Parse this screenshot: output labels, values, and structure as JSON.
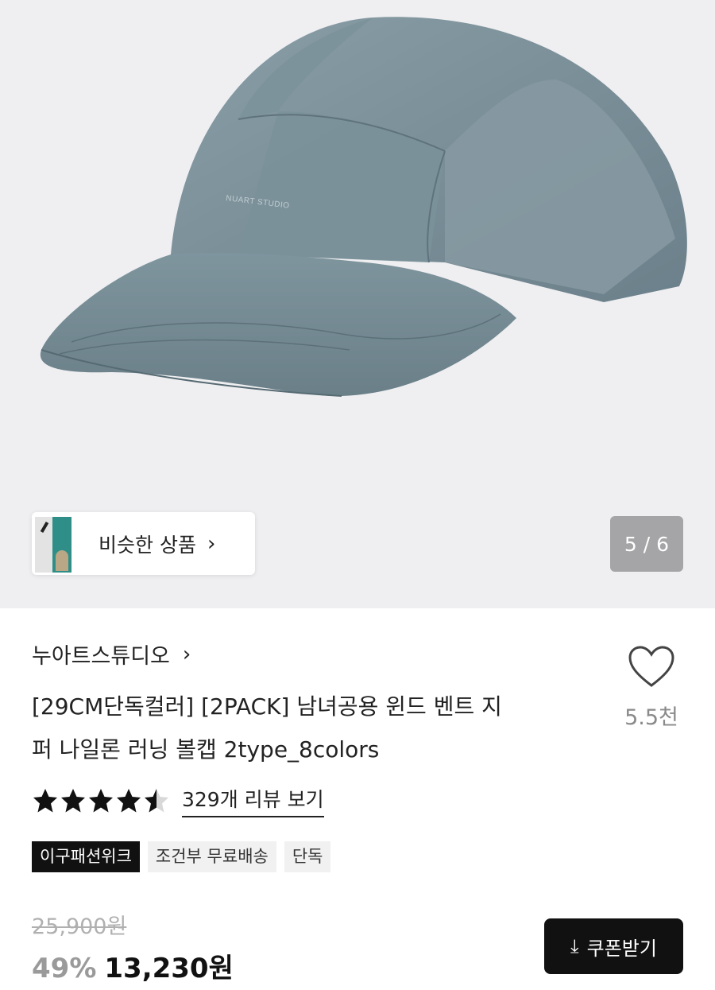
{
  "product_image": {
    "logo_text": "NUART STUDIO",
    "cap_color": "#7a909a"
  },
  "similar_products": {
    "label": "비슷한 상품",
    "chevron_icon": "chevron-right-icon"
  },
  "image_pager": {
    "text": "5 / 6",
    "current": 5,
    "total": 6
  },
  "brand": {
    "name": "누아트스튜디오",
    "chevron_icon": "chevron-right-icon"
  },
  "product": {
    "title_line1": "[29CM단독컬러] [2PACK] 남녀공용 윈드 벤트 지",
    "title_line2": "퍼 나일론 러닝 볼캡 2type_8colors"
  },
  "like": {
    "icon": "heart-outline-icon",
    "count": "5.5천"
  },
  "rating": {
    "stars": 4.5,
    "max": 5,
    "review_link": "329개 리뷰 보기"
  },
  "tags": [
    "이구패션위크",
    "조건부 무료배송",
    "단독"
  ],
  "pricing": {
    "original": "25,900원",
    "discount": "49%",
    "price": "13,230원"
  },
  "coupon_button": {
    "icon": "download-icon",
    "label": "쿠폰받기"
  },
  "colors": {
    "accent_dark": "#111111",
    "muted_gray": "#8a8a8a",
    "hero_bg": "#efeff1"
  }
}
